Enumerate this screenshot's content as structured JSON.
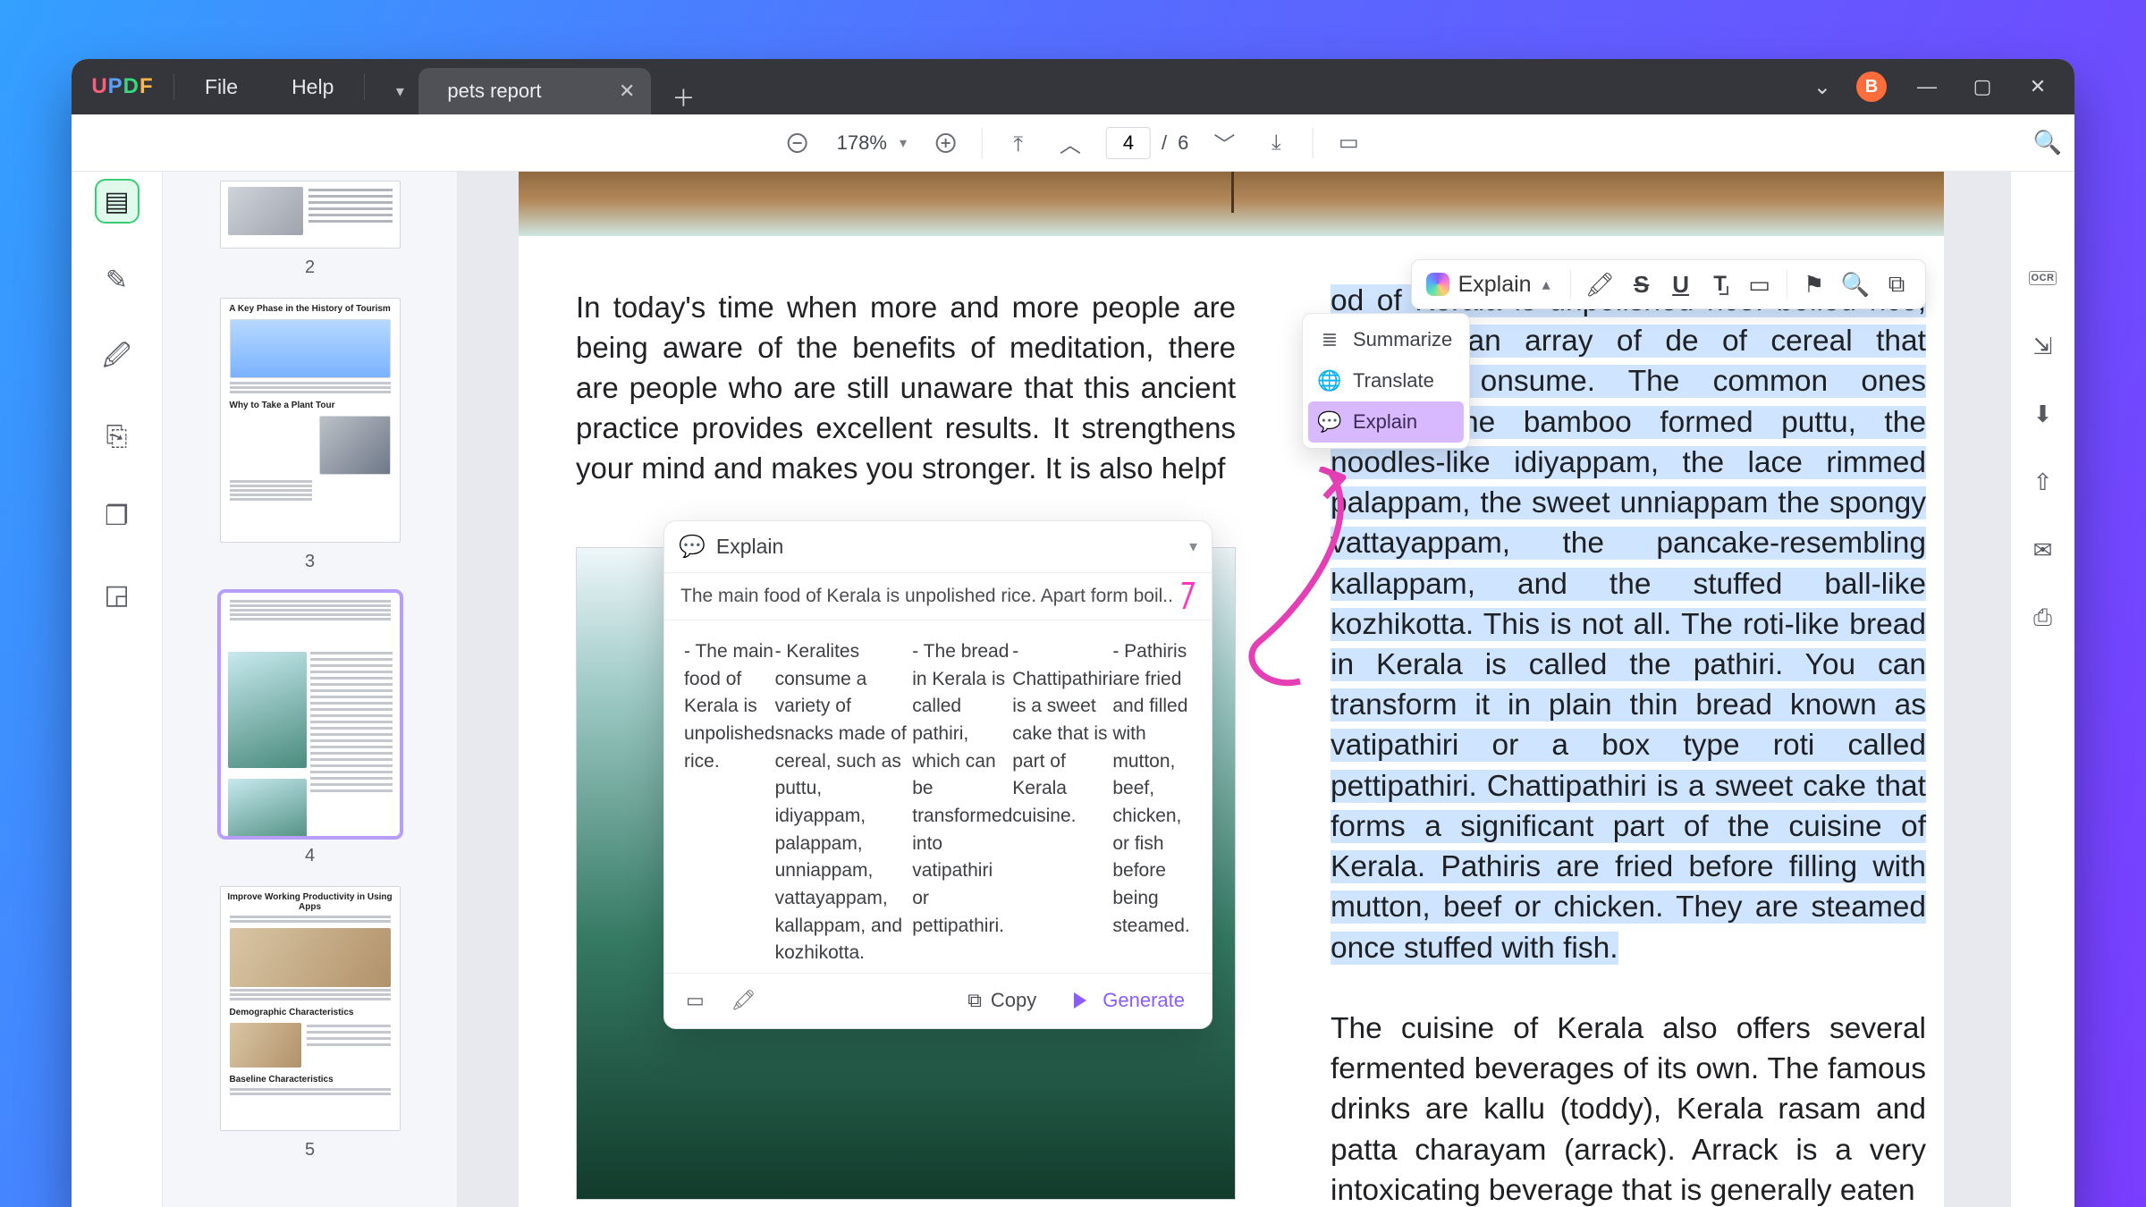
{
  "app": {
    "logo_text": "UPDF"
  },
  "menubar": {
    "file": "File",
    "help": "Help"
  },
  "tab": {
    "title": "pets report"
  },
  "avatar": {
    "initial": "B"
  },
  "toolbar": {
    "zoom_pct": "178%",
    "page_current": "4",
    "page_sep": "/",
    "page_total": "6"
  },
  "thumbnails": {
    "n2": "2",
    "n3": "3",
    "t3_title": "A Key Phase in the History of Tourism",
    "t3_sub": "Why to Take a Plant Tour",
    "n4": "4",
    "n5": "5",
    "t5_title1": "Improve Working Productivity in Using Apps",
    "t5_title2": "Demographic Characteristics",
    "t5_title3": "Baseline Characteristics"
  },
  "page_text": {
    "left_p1": "In today's time when more and more people are being aware of the benefits of meditation, there are people who are still unaware that this ancient practice provides excellent results. It strengthens your mind and makes you stronger. It is also helpf",
    "right_sel": "od of Kerala is unpolished rice. boiled rice, there is an array of de of cereal that Keralites onsume. The common ones include the bamboo formed puttu, the noodles-like idiyappam, the lace rimmed palappam, the sweet unniappam the spongy vattayappam, the pancake-resembling kallappam, and the stuffed ball-like kozhikotta. This is not all. The roti-like bread in Kerala is called the pathiri. You can transform it in plain thin bread known as vatipathiri or a box type roti called pettipathiri. Chattipathiri is a sweet cake that forms a significant part of the cuisine of Kerala. Pathiris are fried before filling with mutton, beef or chicken. They are steamed once stuffed with fish.",
    "right_p2": "The cuisine of Kerala also offers several fermented beverages of its own. The famous drinks are kallu (toddy), Kerala rasam and patta charayam (arrack). Arrack is a very intoxicating beverage that is generally eaten"
  },
  "selection_toolbar": {
    "explain": "Explain"
  },
  "ai_menu": {
    "summarize": "Summarize",
    "translate": "Translate",
    "explain": "Explain"
  },
  "panel": {
    "title": "Explain",
    "query": "The main food of Kerala is unpolished rice. Apart form boil..",
    "bullets": [
      "- The main food of Kerala is unpolished rice.",
      "- Keralites consume a variety of snacks made of cereal, such as puttu, idiyappam, palappam, unniappam, vattayappam, kallappam, and kozhikotta.",
      "- The bread in Kerala is called pathiri, which can be transformed into vatipathiri or pettipathiri.",
      "- Chattipathiri is a sweet cake that is part of Kerala cuisine.",
      "- Pathiris are fried and filled with mutton, beef, chicken, or fish before being steamed."
    ],
    "copy": "Copy",
    "generate": "Generate"
  },
  "rightrail": {
    "ocr": "OCR"
  }
}
